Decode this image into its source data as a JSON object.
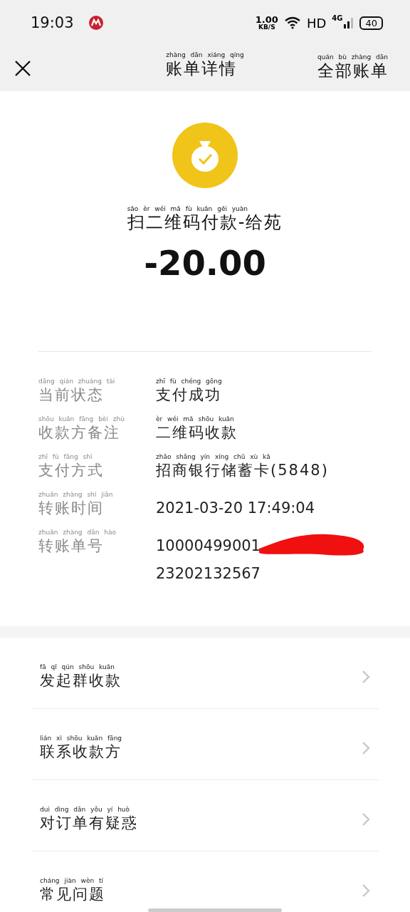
{
  "status_bar": {
    "time": "19:03",
    "speed_value": "1.00",
    "speed_unit": "KB/S",
    "hd": "HD",
    "network": "4G",
    "battery": "40"
  },
  "header": {
    "title": {
      "text": "账单详情",
      "pinyin": "zhàng dān xiáng qíng"
    },
    "all_bills": {
      "text": "全部账单",
      "pinyin": "quán bù zhàng dān"
    }
  },
  "summary": {
    "title": {
      "text": "扫二维码付款-给苑",
      "pinyin": "sǎo èr wéi mǎ fù kuǎn gěi yuàn"
    },
    "amount": "-20.00"
  },
  "details": [
    {
      "label": {
        "text": "当前状态",
        "pinyin": "dāng qián zhuàng tài"
      },
      "value": {
        "text": "支付成功",
        "pinyin": "zhī fù chéng gōng"
      }
    },
    {
      "label": {
        "text": "收款方备注",
        "pinyin": "shōu kuǎn fāng bèi zhù"
      },
      "value": {
        "text": "二维码收款",
        "pinyin": "èr wéi mǎ shōu kuǎn"
      }
    },
    {
      "label": {
        "text": "支付方式",
        "pinyin": "zhī fù fāng shì"
      },
      "value": {
        "text": "招商银行储蓄卡(5848)",
        "pinyin": "zhāo shāng yín xíng chǔ xù kǎ"
      }
    },
    {
      "label": {
        "text": "转账时间",
        "pinyin": "zhuǎn zhàng shí jiān"
      },
      "value": {
        "plain": "2021-03-20 17:49:04"
      }
    },
    {
      "label": {
        "text": "转账单号",
        "pinyin": "zhuǎn zhàng dān hào"
      },
      "value": {
        "plain": "10000499001",
        "plain2": "23202132567",
        "redacted": true
      }
    }
  ],
  "menu": [
    {
      "text": "发起群收款",
      "pinyin": "fā qǐ qún shōu kuǎn"
    },
    {
      "text": "联系收款方",
      "pinyin": "lián xì shōu kuǎn fāng"
    },
    {
      "text": "对订单有疑惑",
      "pinyin": "duì dìng dān yǒu yí huò"
    },
    {
      "text": "常见问题",
      "pinyin": "cháng jiàn wèn tí"
    }
  ]
}
